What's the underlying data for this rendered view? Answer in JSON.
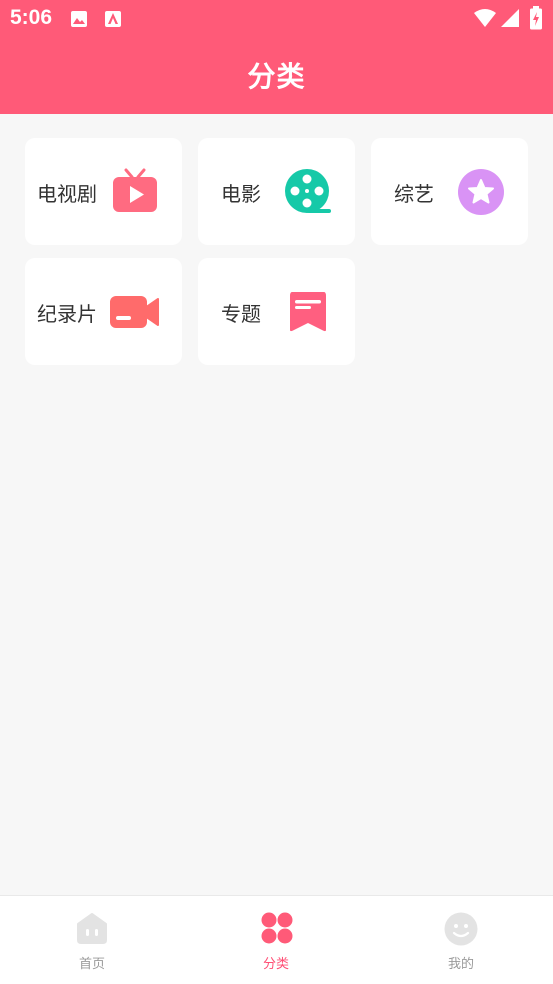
{
  "status_bar": {
    "time": "5:06"
  },
  "header": {
    "title": "分类"
  },
  "categories": [
    {
      "label": "电视剧",
      "icon": "tv-icon",
      "color": "#ff6b81"
    },
    {
      "label": "电影",
      "icon": "film-reel-icon",
      "color": "#16c9a8"
    },
    {
      "label": "综艺",
      "icon": "star-icon",
      "color": "#d993f5"
    },
    {
      "label": "纪录片",
      "icon": "video-camera-icon",
      "color": "#ff6b6b"
    },
    {
      "label": "专题",
      "icon": "bookmark-icon",
      "color": "#ff5f80"
    }
  ],
  "bottom_nav": {
    "items": [
      {
        "label": "首页",
        "icon": "home-icon",
        "active": false
      },
      {
        "label": "分类",
        "icon": "category-grid-icon",
        "active": true
      },
      {
        "label": "我的",
        "icon": "profile-face-icon",
        "active": false
      }
    ]
  },
  "colors": {
    "primary": "#ff5a78",
    "background": "#f7f7f7",
    "nav_active": "#ff4f75",
    "nav_inactive": "#9a9a9a"
  }
}
